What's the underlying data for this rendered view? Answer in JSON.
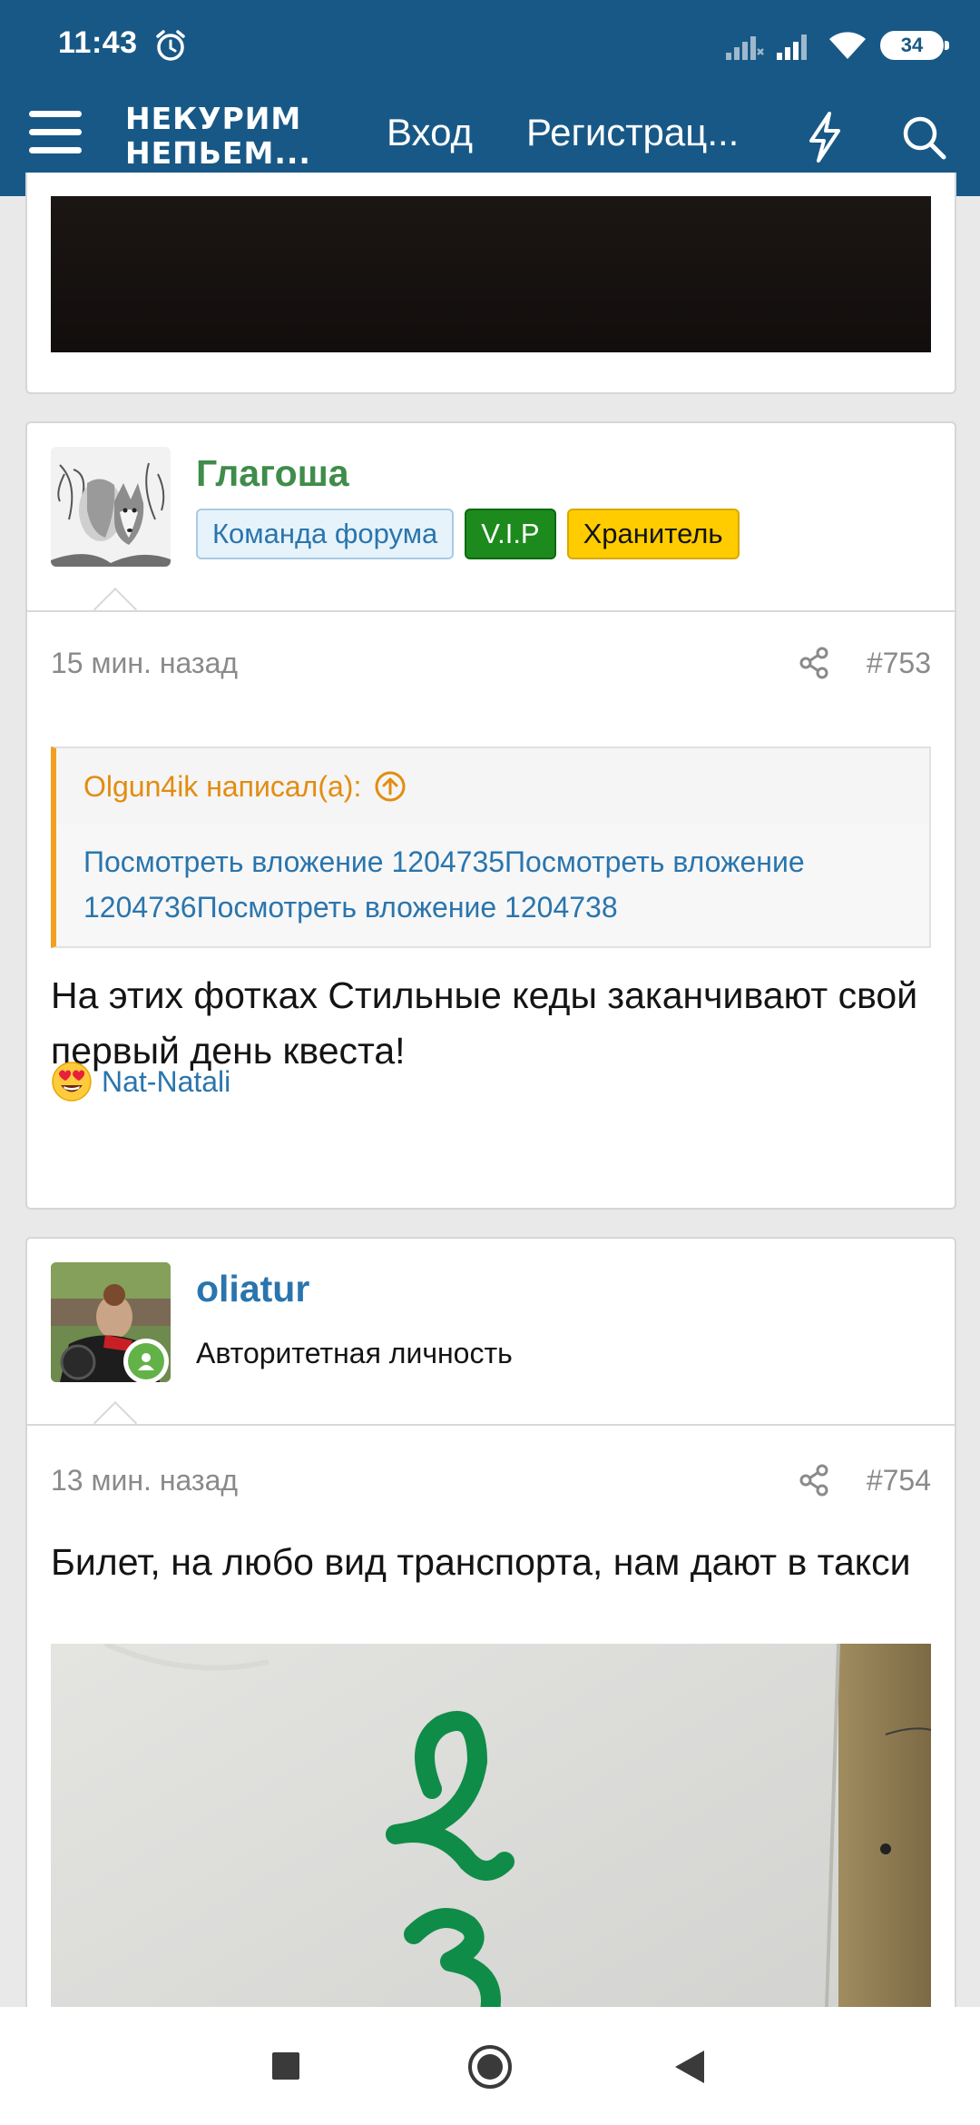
{
  "status_bar": {
    "time": "11:43",
    "battery": "34",
    "icons": [
      "alarm-icon",
      "signal-icon",
      "signal-icon",
      "wifi-icon",
      "battery-icon"
    ]
  },
  "nav": {
    "logo_line1": "НЕКУРИМ",
    "logo_line2": "НЕПЬЕМ...",
    "login": "Вход",
    "register": "Регистрац...",
    "icons": [
      "menu-icon",
      "bolt-icon",
      "search-icon"
    ]
  },
  "posts": [
    {
      "author": "Глагоша",
      "badges": [
        "Команда форума",
        "V.I.P",
        "Хранитель"
      ],
      "time": "15 мин. назад",
      "number": "#753",
      "quote": {
        "author": "Olgun4ik написал(а):",
        "text": "Посмотреть вложение 1204735Посмотреть вложение 1204736Посмотреть вложение 1204738"
      },
      "text": "На этих фотках Стильные кеды заканчивают свой первый день квеста!",
      "reaction": {
        "emoji": "heart-eyes",
        "user": "Nat-Natali"
      }
    },
    {
      "author": "oliatur",
      "title": "Авторитетная личность",
      "time": "13 мин. назад",
      "number": "#754",
      "text": "Билет, на любо вид транспорта, нам дают в такси"
    }
  ],
  "colors": {
    "header": "#185886",
    "author_green": "#3f8c4b",
    "link_blue": "#2a75ad",
    "quote_accent": "#f0a01e",
    "vip_green": "#1d8a1d",
    "keeper_yellow": "#ffcc00"
  },
  "system_nav": [
    "square-icon",
    "circle-icon",
    "back-triangle-icon"
  ]
}
